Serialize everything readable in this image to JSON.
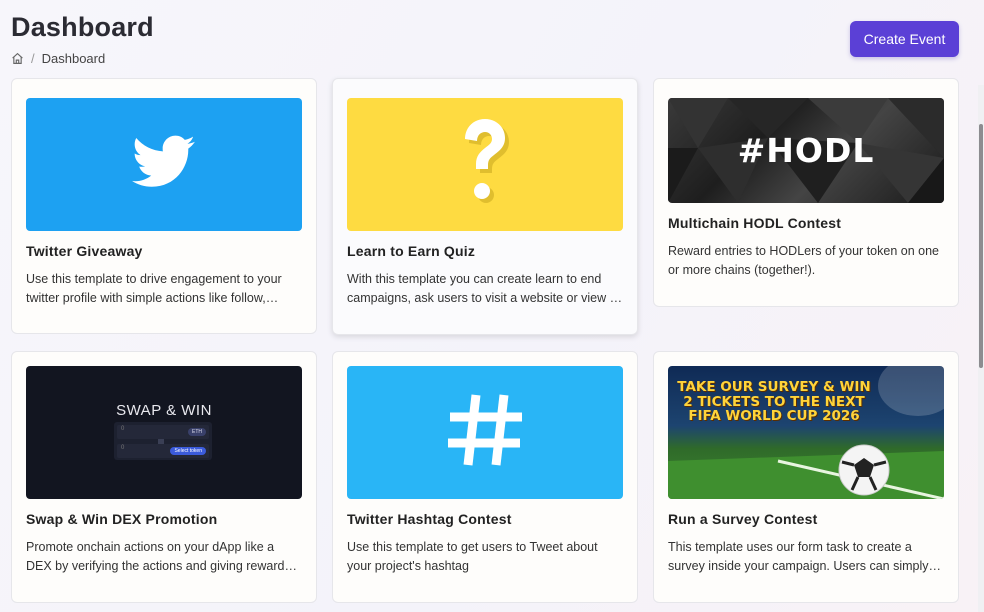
{
  "header": {
    "title": "Dashboard",
    "breadcrumb": {
      "current": "Dashboard",
      "separator": "/"
    }
  },
  "create_button": {
    "label": "Create Event"
  },
  "cards": [
    {
      "title": "Twitter Giveaway",
      "description": "Use this template to drive engagement to your twitter profile with simple actions like follow, retweet...",
      "image": {
        "icon": "twitter-bird-icon",
        "bg": "#1da1f2"
      }
    },
    {
      "title": "Learn to Earn Quiz",
      "description": "With this template you can create learn to end campaigns, ask users to visit a website or view a video...",
      "image": {
        "icon": "question-mark-icon",
        "bg": "#fedb41"
      }
    },
    {
      "title": "Multichain HODL Contest",
      "description": "Reward entries to HODLers of your token on one or more chains (together!).",
      "image": {
        "text": "#HODL",
        "bg": "#2a2a2a"
      }
    },
    {
      "title": "Swap & Win DEX Promotion",
      "description": "Promote onchain actions on your dApp like a DEX by verifying the actions and giving rewards to users...",
      "image": {
        "text": "SWAP & WIN",
        "bg": "#121520",
        "token_label": "ETH",
        "select_label": "Select token",
        "amount_top": "0",
        "amount_bottom": "0"
      }
    },
    {
      "title": "Twitter Hashtag Contest",
      "description": "Use this template to get users to Tweet about your project's hashtag",
      "image": {
        "icon": "hashtag-icon",
        "bg": "#29b5f6"
      }
    },
    {
      "title": "Run a Survey Contest",
      "description": "This template uses our form task to create a survey inside your campaign. Users can simply fill the form...",
      "image": {
        "text": "TAKE OUR SURVEY & WIN 2 TICKETS TO THE NEXT FIFA WORLD CUP 2026",
        "bg": "#0f2a55"
      }
    }
  ],
  "colors": {
    "accent": "#5b40d6"
  }
}
